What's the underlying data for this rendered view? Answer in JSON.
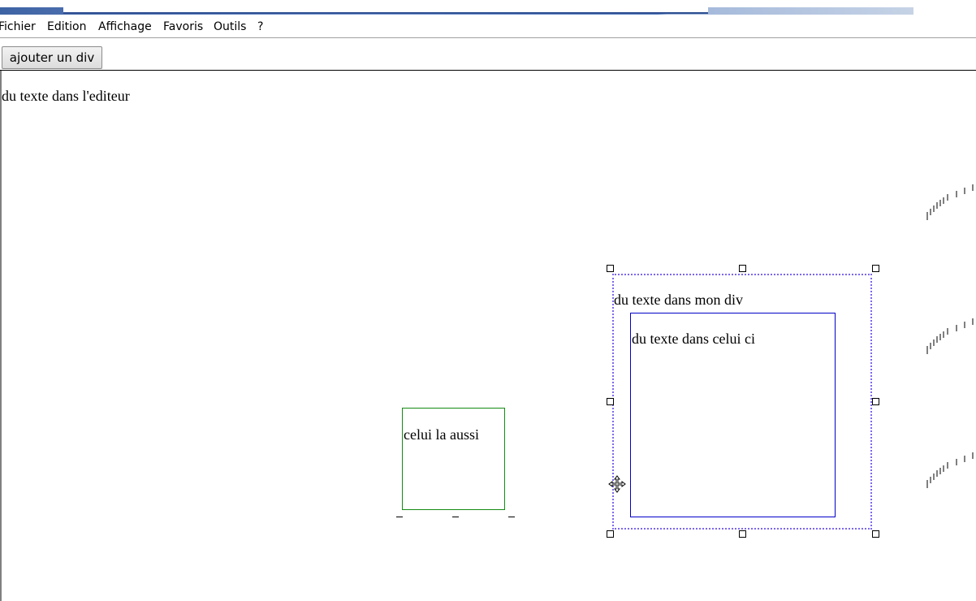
{
  "menubar": {
    "items": [
      "Fichier",
      "Edition",
      "Affichage",
      "Favoris",
      "Outils",
      "?"
    ]
  },
  "toolbar": {
    "add_div_label": "ajouter un div"
  },
  "editor": {
    "text": "du texte dans l'editeur",
    "green_div_text": "celui la aussi",
    "selected_div_text": "du texte dans mon div",
    "inner_div_text": "du texte dans celui ci"
  },
  "colors": {
    "selection_border": "#7b68ee",
    "green_div_border": "#138a13",
    "blue_div_border": "#0000c8",
    "title_band": "#3e63a4"
  },
  "icons": {
    "cursor": "move-cursor-icon"
  }
}
